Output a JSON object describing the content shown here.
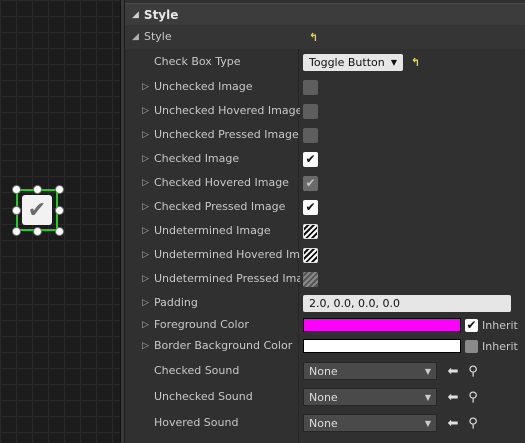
{
  "section": {
    "title": "Style"
  },
  "style_group": {
    "label": "Style"
  },
  "check_box_type": {
    "label": "Check Box Type",
    "value": "Toggle Button"
  },
  "images": [
    {
      "label": "Unchecked Image",
      "state": "empty"
    },
    {
      "label": "Unchecked Hovered Image",
      "state": "empty"
    },
    {
      "label": "Unchecked Pressed Image",
      "state": "empty"
    },
    {
      "label": "Checked Image",
      "state": "checked"
    },
    {
      "label": "Checked Hovered Image",
      "state": "checked-hovered"
    },
    {
      "label": "Checked Pressed Image",
      "state": "checked"
    },
    {
      "label": "Undetermined Image",
      "state": "hatched"
    },
    {
      "label": "Undetermined Hovered Imag",
      "state": "hatched"
    },
    {
      "label": "Undetermined Pressed Imag",
      "state": "hatched-gray"
    }
  ],
  "padding": {
    "label": "Padding",
    "value": "2.0, 0.0, 0.0, 0.0"
  },
  "foreground_color": {
    "label": "Foreground Color",
    "color": "#ff00ff",
    "inherit_label": "Inherit",
    "inherit_checked": true
  },
  "border_background_color": {
    "label": "Border Background Color",
    "color": "#ffffff",
    "inherit_label": "Inherit",
    "inherit_checked": false
  },
  "sounds": [
    {
      "label": "Checked Sound",
      "value": "None"
    },
    {
      "label": "Unchecked Sound",
      "value": "None"
    },
    {
      "label": "Hovered Sound",
      "value": "None"
    }
  ],
  "icons": {
    "reset": "reset-arrow-icon",
    "use": "left-arrow-icon",
    "browse": "search-icon"
  }
}
